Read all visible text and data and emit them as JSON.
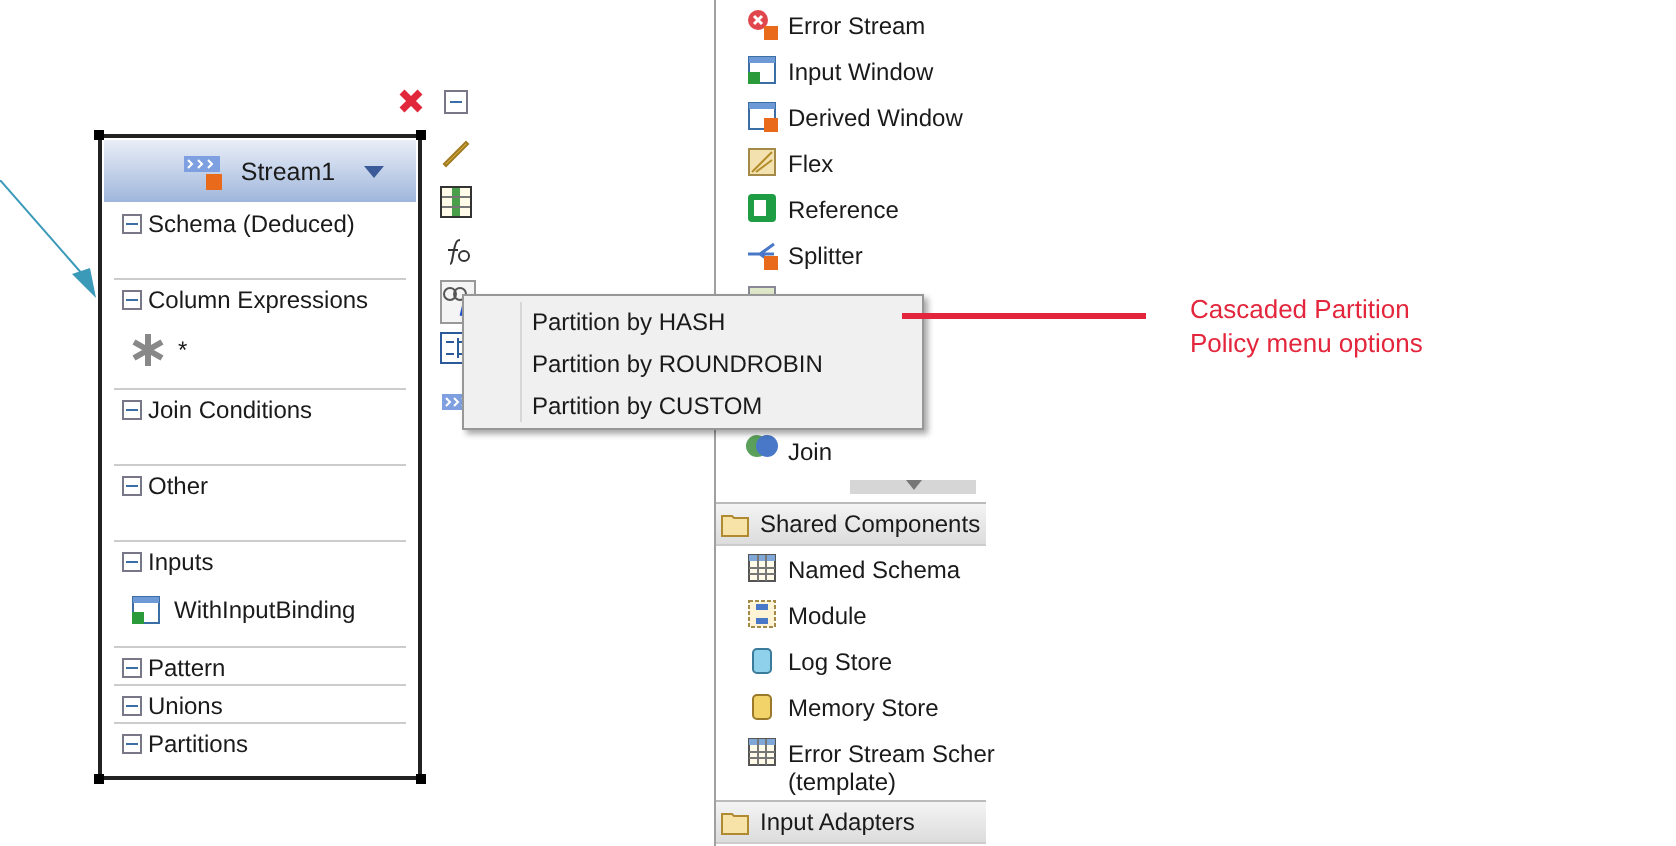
{
  "node": {
    "title": "Stream1",
    "sections": [
      {
        "label": "Schema (Deduced)",
        "expanded": true,
        "kind": "block"
      },
      {
        "label": "Column Expressions",
        "expanded": true,
        "kind": "block",
        "items": [
          {
            "label": "*",
            "kind": "expression"
          }
        ]
      },
      {
        "label": "Join Conditions",
        "expanded": true,
        "kind": "block"
      },
      {
        "label": "Other",
        "expanded": true,
        "kind": "block"
      },
      {
        "label": "Inputs",
        "expanded": true,
        "kind": "block",
        "items": [
          {
            "label": "WithInputBinding",
            "kind": "input"
          }
        ]
      },
      {
        "label": "Pattern",
        "expanded": true,
        "kind": "line"
      },
      {
        "label": "Unions",
        "expanded": true,
        "kind": "line"
      },
      {
        "label": "Partitions",
        "expanded": true,
        "kind": "line"
      }
    ]
  },
  "tools": [
    {
      "kind": "collapse",
      "selected": false
    },
    {
      "kind": "edit",
      "selected": false
    },
    {
      "kind": "schema",
      "selected": false
    },
    {
      "kind": "function",
      "selected": false
    },
    {
      "kind": "partition",
      "selected": true
    },
    {
      "kind": "tree",
      "selected": false
    },
    {
      "kind": "stream",
      "selected": false
    }
  ],
  "menu": {
    "items": [
      {
        "label": "Partition by HASH"
      },
      {
        "label": "Partition by ROUNDROBIN"
      },
      {
        "label": "Partition by CUSTOM"
      }
    ]
  },
  "palette": {
    "groups": [
      {
        "items": [
          {
            "label": "Error Stream",
            "kind": "errorstream"
          },
          {
            "label": "Input Window",
            "kind": "inputwindow"
          },
          {
            "label": "Derived Window",
            "kind": "derivedwindow"
          },
          {
            "label": "Flex",
            "kind": "flex"
          },
          {
            "label": "Reference",
            "kind": "reference"
          },
          {
            "label": "Splitter",
            "kind": "splitter"
          },
          {
            "kind": "hidden"
          },
          {
            "kind": "hidden"
          },
          {
            "kind": "hidden"
          },
          {
            "label": "Join",
            "kind": "join"
          }
        ]
      },
      {
        "header": "Shared Components",
        "items": [
          {
            "label": "Named Schema",
            "kind": "schema"
          },
          {
            "label": "Module",
            "kind": "module"
          },
          {
            "label": "Log Store",
            "kind": "logstore"
          },
          {
            "label": "Memory Store",
            "kind": "memorystore"
          },
          {
            "label_lines": [
              "Error Stream Scher",
              "(template)"
            ],
            "kind": "schema"
          }
        ]
      },
      {
        "header": "Input Adapters"
      }
    ]
  },
  "annotation": {
    "text": "Cascaded Partition Policy menu options"
  }
}
